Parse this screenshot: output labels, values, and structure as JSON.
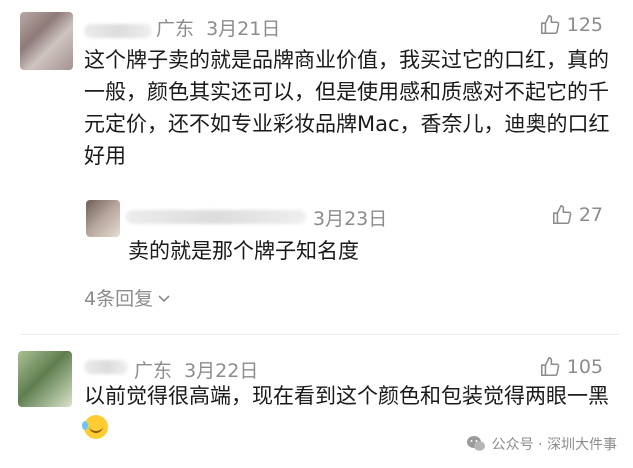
{
  "comments": [
    {
      "location": "广东",
      "date": "3月21日",
      "likes": "125",
      "text": "这个牌子卖的就是品牌商业价值，我买过它的口红，真的一般，颜色其实还可以，但是使用感和质感对不起它的千元定价，还不如专业彩妆品牌Mac，香奈儿，迪奥的口红好用"
    },
    {
      "location": "广东",
      "date": "3月22日",
      "likes": "105",
      "text": "以前觉得很高端，现在看到这个颜色和包装觉得两眼一黑"
    }
  ],
  "reply": {
    "date": "3月23日",
    "likes": "27",
    "text": "卖的就是那个牌子知名度"
  },
  "replies_link": "4条回复",
  "footer": {
    "label": "公众号 · 深圳大件事"
  },
  "icons": {
    "like": "thumbs-up-icon",
    "expand": "chevron-down-icon",
    "wechat": "wechat-icon",
    "emoji": "laugh-cry-emoji-icon"
  }
}
